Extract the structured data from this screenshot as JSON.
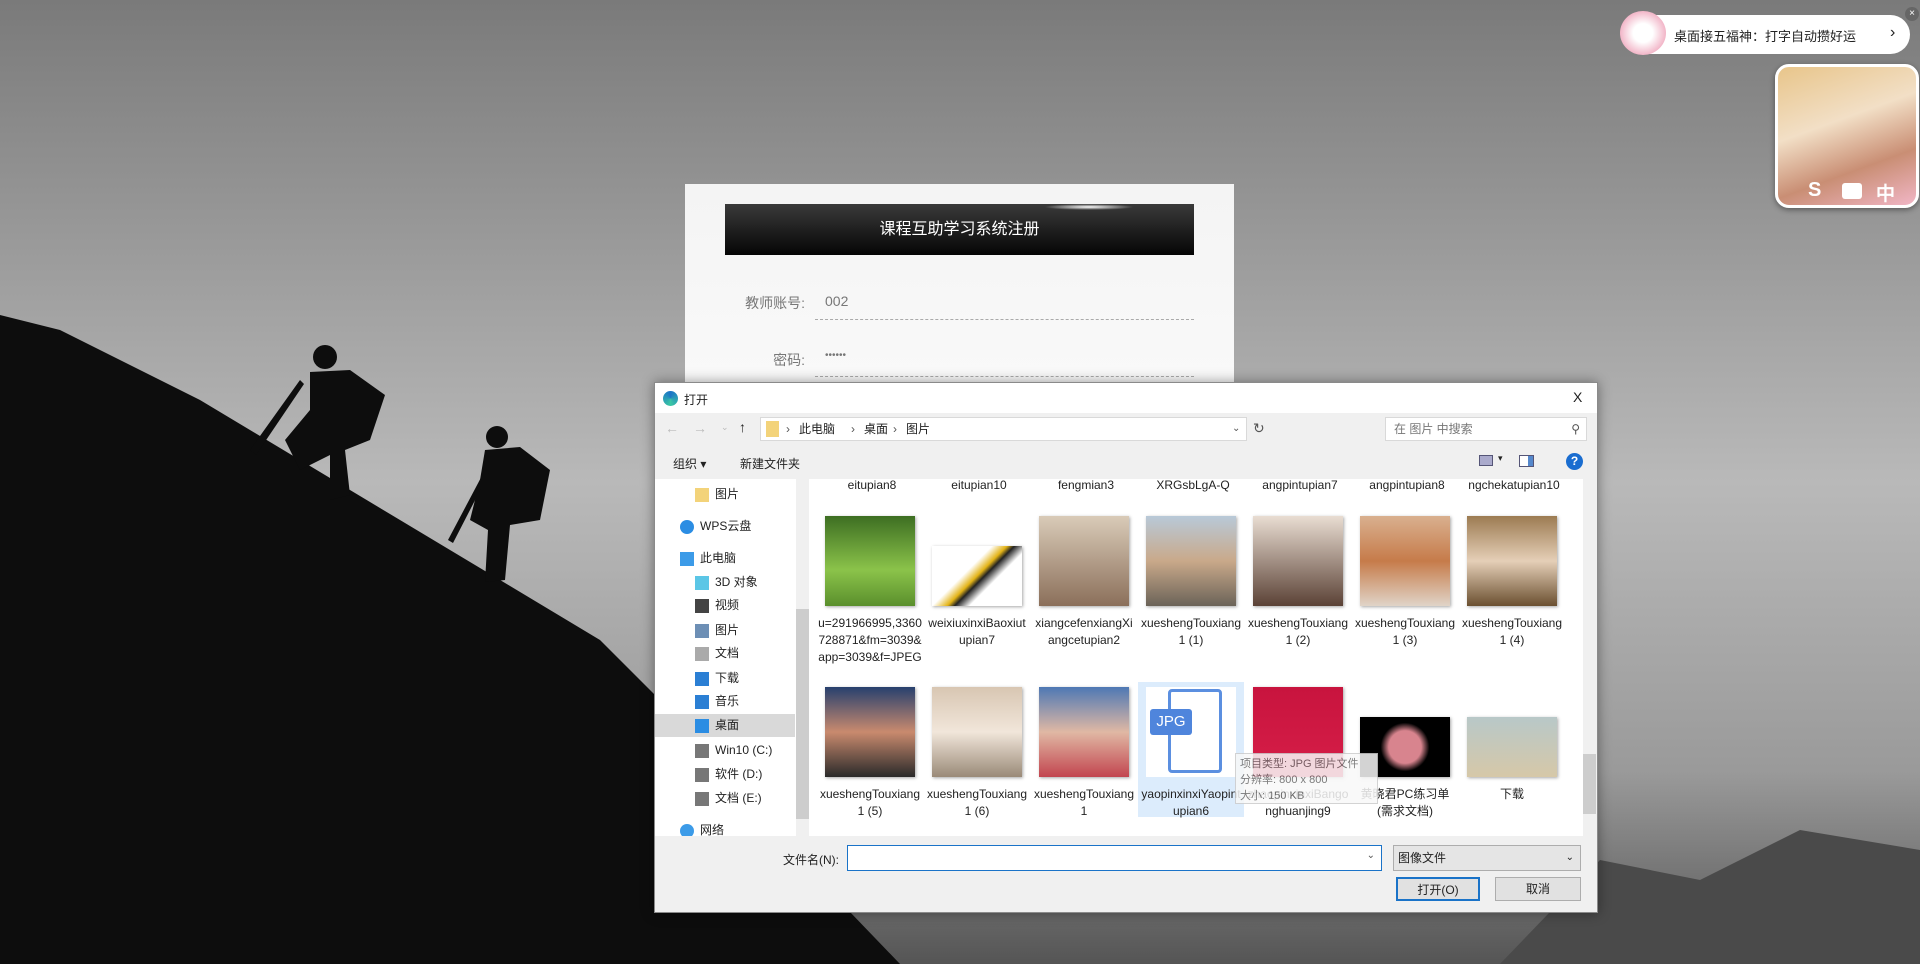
{
  "registration": {
    "title": "课程互助学习系统注册",
    "account_label": "教师账号:",
    "account_value": "002",
    "password_label": "密码:",
    "password_value": "••••••"
  },
  "widget": {
    "banner_text": "桌面接五福神：打字自动攒好运",
    "banner_arrow": "›",
    "close": "×",
    "card_icons": [
      "S",
      "中"
    ]
  },
  "dialog": {
    "title": "打开",
    "close": "X",
    "breadcrumb": [
      "此电脑",
      "桌面",
      "图片"
    ],
    "search_placeholder": "在 图片 中搜索",
    "toolbar": {
      "organize": "组织 ▾",
      "new_folder": "新建文件夹",
      "help": "?"
    },
    "nav": [
      {
        "label": "图片",
        "icon": "folder-icon",
        "color": "#f3d37a"
      },
      {
        "label": "WPS云盘",
        "icon": "cloud-icon",
        "color": "#2b8de3"
      },
      {
        "label": "此电脑",
        "icon": "computer-icon",
        "color": "#3c9be8"
      },
      {
        "label": "3D 对象",
        "icon": "cube-icon",
        "color": "#5bc6e6"
      },
      {
        "label": "视频",
        "icon": "video-icon",
        "color": "#444"
      },
      {
        "label": "图片",
        "icon": "picture-icon",
        "color": "#6d8fb5"
      },
      {
        "label": "文档",
        "icon": "document-icon",
        "color": "#aaa"
      },
      {
        "label": "下载",
        "icon": "download-icon",
        "color": "#2b7fd4"
      },
      {
        "label": "音乐",
        "icon": "music-icon",
        "color": "#2b7fd4"
      },
      {
        "label": "桌面",
        "icon": "desktop-icon",
        "color": "#2b8de3",
        "selected": true
      },
      {
        "label": "Win10 (C:)",
        "icon": "drive-icon",
        "color": "#777"
      },
      {
        "label": "软件 (D:)",
        "icon": "drive-icon",
        "color": "#777"
      },
      {
        "label": "文档 (E:)",
        "icon": "drive-icon",
        "color": "#777"
      },
      {
        "label": "网络",
        "icon": "network-icon",
        "color": "#3c9be8"
      }
    ],
    "partial_labels": [
      "eitupian8",
      "eitupian10",
      "fengmian3",
      "XRGsbLgA-Q",
      "angpintupian7",
      "angpintupian8",
      "ngchekatupian10"
    ],
    "files": [
      {
        "name": "u=291966995,3360728871&fm=3039&app=3039&f=JPEG",
        "thumb": "linear-gradient(#3d6e22,#8bc34a 60%,#5a8f2c)"
      },
      {
        "name": "weixiuxinxiBaoxiutupian7",
        "thumb": "linear-gradient(135deg,#fff 40%,#e3b316 50%,#222 55%,#fff 65%)",
        "short": true
      },
      {
        "name": "xiangcefenxiangXiangcetupian2",
        "thumb": "linear-gradient(#d9cbb8,#8b6f5a)"
      },
      {
        "name": "xueshengTouxiang1 (1)",
        "thumb": "linear-gradient(#b8c9d8,#c9a98a 50%,#6b6358)"
      },
      {
        "name": "xueshengTouxiang1 (2)",
        "thumb": "linear-gradient(#e9ddd2,#5b4236)"
      },
      {
        "name": "xueshengTouxiang1 (3)",
        "thumb": "linear-gradient(#d9b08f,#c67b4a 50%,#e0d4c8)"
      },
      {
        "name": "xueshengTouxiang1 (4)",
        "thumb": "linear-gradient(#9c7b52,#e5cfb7 50%,#6b5030)"
      },
      {
        "name": "xueshengTouxiang1 (5)",
        "thumb": "linear-gradient(#27406e,#c98a6e 50%,#2a2a2a)"
      },
      {
        "name": "xueshengTouxiang1 (6)",
        "thumb": "linear-gradient(#d8c6b2,#f1e6da 50%,#9a8a78)"
      },
      {
        "name": "xueshengTouxiang1",
        "thumb": "linear-gradient(#4e78b4,#e0b8a4 50%,#c2454f)"
      },
      {
        "name": "yaopinxinxiYaopintupian6",
        "thumb": "jpg",
        "selected": true
      },
      {
        "name": "zhaopinxinxiBangonghuanjing9",
        "thumb": "linear-gradient(#c8143e,#d61e48)"
      },
      {
        "name": "黄晓君PC练习单(需求文档)",
        "thumb": "radial-gradient(circle,#d8848e 30%,#000 45%)",
        "short": true
      },
      {
        "name": "下载",
        "thumb": "linear-gradient(#b8c8c8,#d6c8a8)",
        "short": true
      }
    ],
    "tooltip": [
      "项目类型: JPG 图片文件",
      "分辨率: 800 x 800",
      "大小: 150 KB"
    ],
    "filename_label": "文件名(N):",
    "filename_value": "",
    "filetype": "图像文件",
    "open_button": "打开(O)",
    "cancel_button": "取消"
  }
}
